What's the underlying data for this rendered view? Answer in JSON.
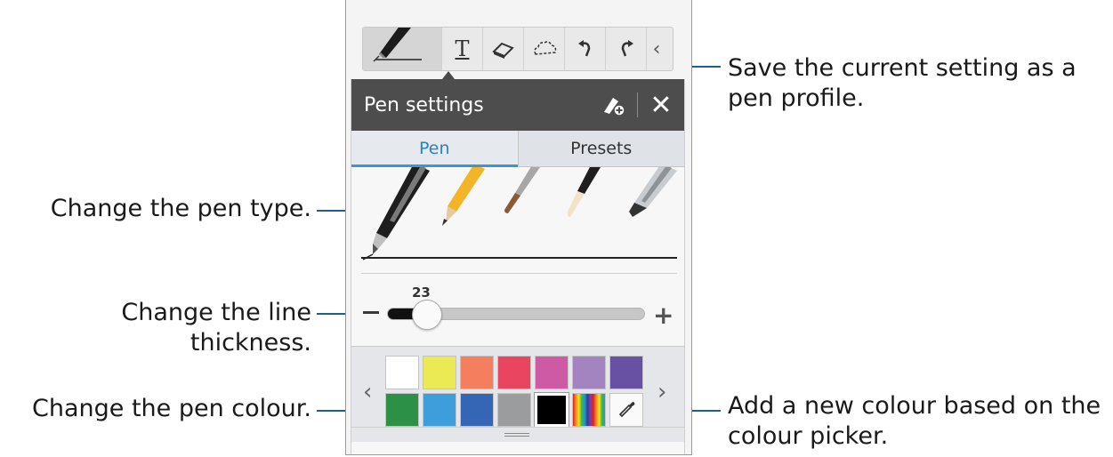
{
  "callouts": {
    "save_profile": "Save the current setting as a pen profile.",
    "pen_type": "Change the pen type.",
    "line_thickness": "Change the line thickness.",
    "pen_colour": "Change the pen colour.",
    "colour_picker": "Add a new colour based on the colour picker."
  },
  "toolbar": {
    "text_tool_icon": "T",
    "collapse_icon": "‹"
  },
  "panel": {
    "title": "Pen settings",
    "tabs": [
      {
        "label": "Pen",
        "active": true
      },
      {
        "label": "Presets",
        "active": false
      }
    ],
    "thickness": {
      "value": "23",
      "fraction": 0.12
    },
    "colors_row1": [
      "#ffffff",
      "#ebe954",
      "#f47e5e",
      "#e94560",
      "#ce5aa6",
      "#a384c0",
      "#6851a3"
    ],
    "colors_row2": [
      "#2c9146",
      "#3e9edc",
      "#3466b5",
      "#9b9c9e",
      "#000000"
    ],
    "prev_arrow": "‹",
    "next_arrow": "›"
  },
  "colors": {
    "leader": "#1f5f8f",
    "header_bg": "#4d4d4d",
    "tab_active": "#2b82c2"
  }
}
